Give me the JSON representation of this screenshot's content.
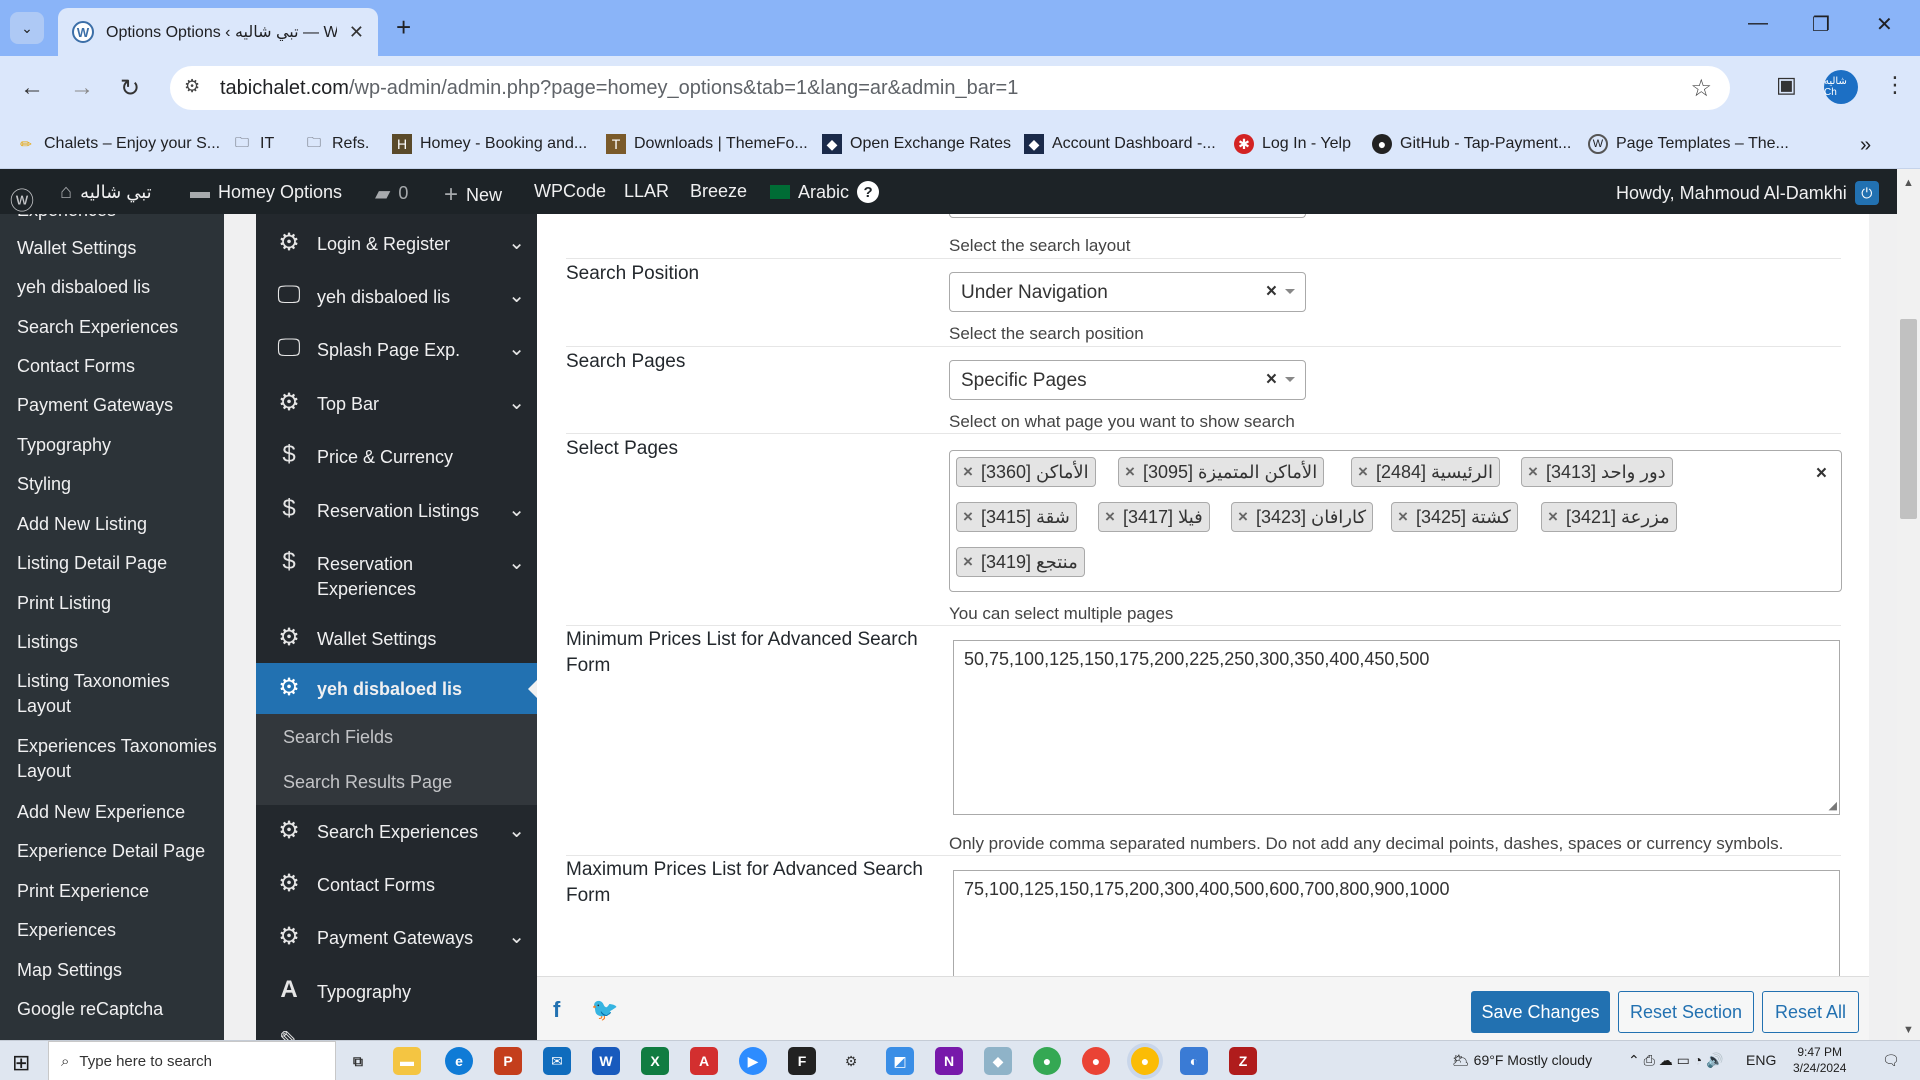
{
  "browser": {
    "tab_title": "Options Options ‹ تبي شاليه — Wo",
    "url_main": "tabichalet.com",
    "url_rest": "/wp-admin/admin.php?page=homey_options&tab=1&lang=ar&admin_bar=1",
    "bookmarks": [
      "Chalets – Enjoy your S...",
      "IT",
      "Refs.",
      "Homey - Booking and...",
      "Downloads | ThemeFo...",
      "Open Exchange Rates",
      "Account Dashboard -...",
      "Log In - Yelp",
      "GitHub - Tap-Payment...",
      "Page Templates – The..."
    ],
    "avatar_text": "شاليه Ch"
  },
  "adminbar": {
    "site_name": "تبي شاليه",
    "homey_options": "Homey Options",
    "comments_count": "0",
    "new_label": "New",
    "wpcode": "WPCode",
    "llar": "LLAR",
    "breeze": "Breeze",
    "language": "Arabic",
    "help": "?",
    "howdy": "Howdy, Mahmoud Al-Damkhi"
  },
  "wp_sidebar": {
    "items": [
      "Experiences",
      "Wallet Settings",
      "yeh disbaloed lis",
      "Search Experiences",
      "Contact Forms",
      "Payment Gateways",
      "Typography",
      "Styling",
      "Add New Listing",
      "Listing Detail Page",
      "Print Listing",
      "Listings",
      "Listing Taxonomies Layout",
      "Experiences Taxonomies Layout",
      "Add New Experience",
      "Experience Detail Page",
      "Print Experience",
      "Experiences",
      "Map Settings",
      "Google reCaptcha"
    ]
  },
  "options_nav": {
    "items": [
      {
        "label": "Login & Register",
        "icon": "gear-icon"
      },
      {
        "label": "yeh disbaloed lis",
        "icon": "monitor-icon"
      },
      {
        "label": "Splash Page Exp.",
        "icon": "monitor-icon"
      },
      {
        "label": "Top Bar",
        "icon": "gear-icon"
      },
      {
        "label": "Price & Currency",
        "icon": "dollar-icon"
      },
      {
        "label": "Reservation Listings",
        "icon": "dollar-icon"
      },
      {
        "label": "Reservation Experiences",
        "icon": "dollar-icon"
      },
      {
        "label": "Wallet Settings",
        "icon": "gear-icon"
      },
      {
        "label": "yeh disbaloed lis",
        "icon": "gear-icon"
      },
      {
        "label": "Search Experiences",
        "icon": "gear-icon"
      },
      {
        "label": "Contact Forms",
        "icon": "gear-icon"
      },
      {
        "label": "Payment Gateways",
        "icon": "gear-icon"
      },
      {
        "label": "Typography",
        "icon": "typography-icon"
      }
    ],
    "submenu": [
      "Search Fields",
      "Search Results Page"
    ]
  },
  "form": {
    "layout_desc": "Select the search layout",
    "position": {
      "label": "Search Position",
      "value": "Under Navigation",
      "desc": "Select the search position"
    },
    "pages": {
      "label": "Search Pages",
      "value": "Specific Pages",
      "desc": "Select on what page you want to show search"
    },
    "select_pages": {
      "label": "Select Pages",
      "chips": [
        "الأماكن [3360]",
        "الأماكن المتميزة [3095]",
        "الرئيسية [2484]",
        "دور واحد [3413]",
        "شقة [3415]",
        "فيلا [3417]",
        "كارافان [3423]",
        "كشتة [3425]",
        "مزرعة [3421]",
        "منتجع [3419]"
      ],
      "desc": "You can select multiple pages"
    },
    "min_prices": {
      "label": "Minimum Prices List for Advanced Search Form",
      "value": "50,75,100,125,150,175,200,225,250,300,350,400,450,500",
      "desc": "Only provide comma separated numbers. Do not add any decimal points, dashes, spaces or currency symbols."
    },
    "max_prices": {
      "label": "Maximum Prices List for Advanced Search Form",
      "value": "75,100,125,150,175,200,300,400,500,600,700,800,900,1000"
    }
  },
  "footer": {
    "save": "Save Changes",
    "reset_section": "Reset Section",
    "reset_all": "Reset All"
  },
  "taskbar": {
    "search_placeholder": "Type here to search",
    "weather": "69°F  Mostly cloudy",
    "lang": "ENG",
    "time": "9:47 PM",
    "date": "3/24/2024"
  }
}
